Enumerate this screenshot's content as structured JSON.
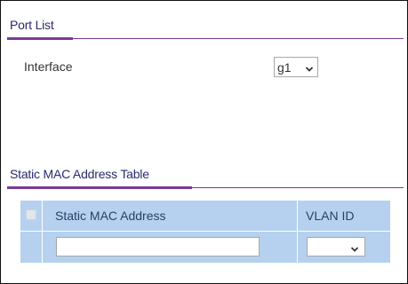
{
  "port_list": {
    "title": "Port List",
    "interface_label": "Interface",
    "interface_value": "g1"
  },
  "static_mac_table": {
    "title": "Static MAC Address Table",
    "columns": {
      "mac": "Static MAC Address",
      "vlan": "VLAN ID"
    },
    "new_row": {
      "mac_value": "",
      "vlan_value": ""
    }
  },
  "colors": {
    "accent": "#7b3a96",
    "table_bg": "#b5d1ef",
    "title_text": "#2a2a6e"
  },
  "icons": {
    "dropdown": "chevron-down-icon"
  }
}
